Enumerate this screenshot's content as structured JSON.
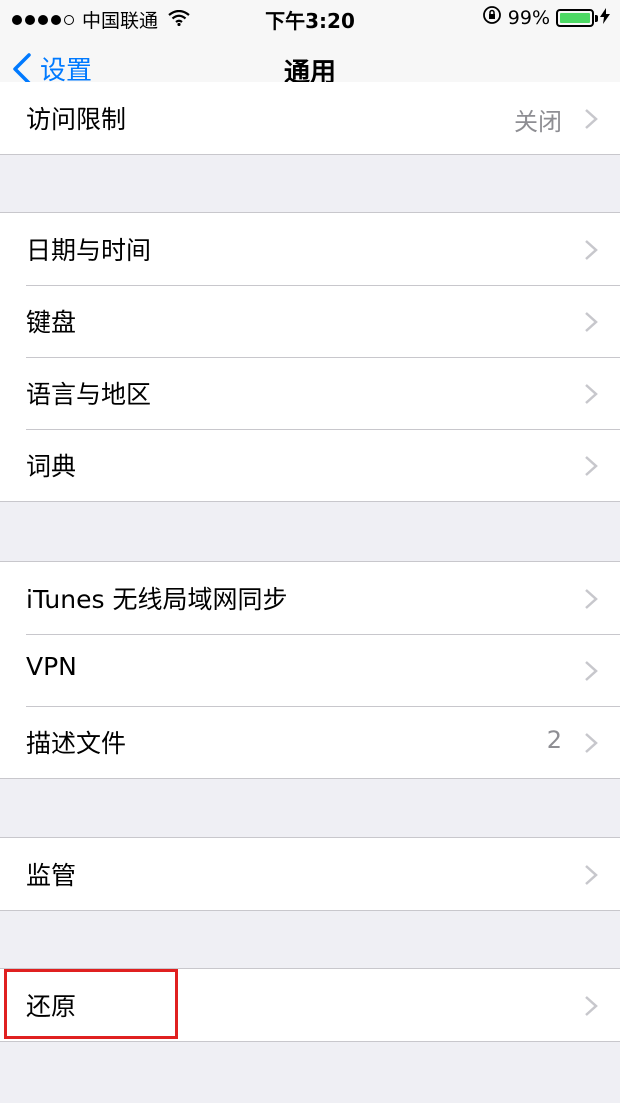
{
  "status_bar": {
    "carrier": "中国联通",
    "time": "下午3:20",
    "battery_percent": "99%",
    "battery_level": 0.99,
    "icons": [
      "signal-dots",
      "wifi-icon",
      "orientation-lock-icon",
      "battery-icon",
      "charging-icon"
    ]
  },
  "nav": {
    "back_label": "设置",
    "title": "通用"
  },
  "groups": [
    {
      "rows": [
        {
          "label": "访问限制",
          "value": "关闭"
        }
      ]
    },
    {
      "rows": [
        {
          "label": "日期与时间"
        },
        {
          "label": "键盘"
        },
        {
          "label": "语言与地区"
        },
        {
          "label": "词典"
        }
      ]
    },
    {
      "rows": [
        {
          "label": "iTunes 无线局域网同步"
        },
        {
          "label": "VPN"
        },
        {
          "label": "描述文件",
          "value": "2"
        }
      ]
    },
    {
      "rows": [
        {
          "label": "监管"
        }
      ]
    },
    {
      "rows": [
        {
          "label": "还原"
        }
      ]
    }
  ],
  "colors": {
    "accent": "#007aff",
    "background": "#efeff4",
    "highlight_box": "#e02020",
    "battery": "#4cd964"
  }
}
